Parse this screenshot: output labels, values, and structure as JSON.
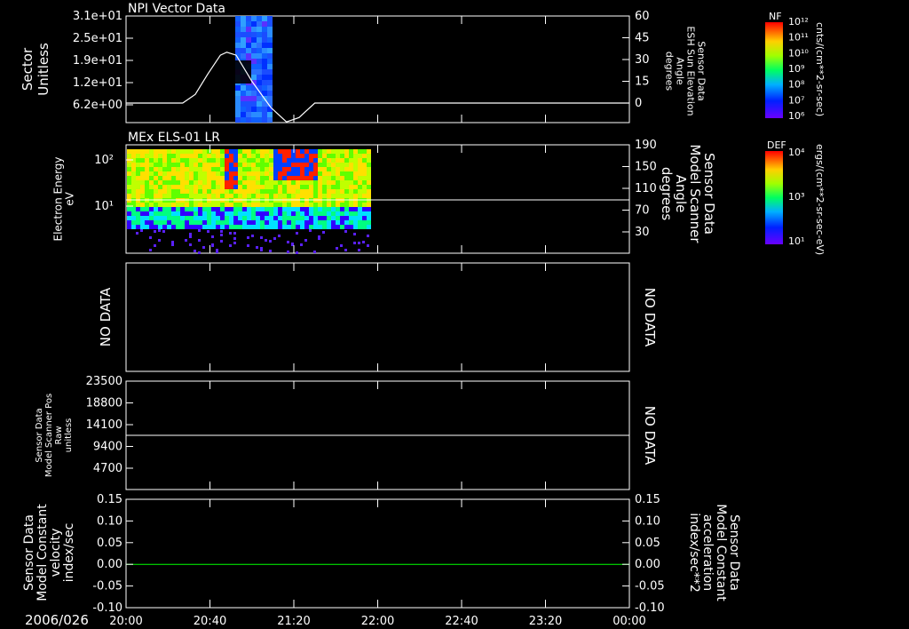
{
  "chart_data": [
    {
      "type": "heatmap",
      "title": "NPI Vector Data",
      "ylabel": "Sector\nUnitless",
      "y_ticks": [
        "3.1e+01",
        "2.5e+01",
        "1.9e+01",
        "1.2e+01",
        "6.2e+00"
      ],
      "y2label": "Sensor Data\nESH Sun Elevation\nAngle\ndegrees",
      "y2_ticks": [
        "60",
        "45",
        "30",
        "15",
        "0"
      ],
      "colorbar": {
        "label": "NF",
        "units": "cnts/(cm**2-sr-sec)",
        "ticks": [
          "10¹²",
          "10¹¹",
          "10¹⁰",
          "10⁹",
          "10⁸",
          "10⁷",
          "10⁶"
        ]
      },
      "line_series": {
        "x_hours": [
          0,
          0.5,
          0.9,
          1.1,
          1.3,
          1.5,
          1.6,
          1.75,
          2.0,
          2.3,
          2.55,
          2.75,
          3.0,
          3.2,
          3.4,
          3.6,
          4.0,
          4.5,
          5.0,
          5.5,
          6.0,
          6.5,
          7.0,
          7.5,
          8.0
        ],
        "y_deg": [
          0,
          0,
          0,
          6,
          20,
          33,
          35,
          33,
          15,
          -3,
          -13,
          -10,
          0,
          0,
          0,
          0,
          0,
          0,
          0,
          0,
          0,
          0,
          0,
          0,
          0
        ]
      }
    },
    {
      "type": "heatmap",
      "title": "MEx ELS-01 LR",
      "ylabel": "Electron Energy\neV",
      "y_ticks": [
        "10²",
        "10¹"
      ],
      "y2label": "Sensor Data\nModel Scanner\nAngle\ndegrees",
      "y2_ticks": [
        "190",
        "150",
        "110",
        "70",
        "30"
      ],
      "colorbar": {
        "label": "DEF",
        "units": "ergs/(cm**2-sr-sec-eV)",
        "ticks": [
          "10⁴",
          "10³",
          "10¹"
        ]
      },
      "hline_value": 100
    },
    {
      "type": "line",
      "ylabel": "NO DATA",
      "y2label": "NO DATA"
    },
    {
      "type": "line",
      "ylabel": "Sensor Data\nModel Scanner Pos\nRaw\nunitless",
      "y_ticks": [
        "23500",
        "18800",
        "14100",
        "9400",
        "4700"
      ],
      "y2label": "NO DATA",
      "ylim": [
        0,
        23500
      ],
      "series": [
        {
          "y": 11750
        }
      ]
    },
    {
      "type": "line",
      "ylabel": "Sensor Data\nModel Constant\nvelocity\nindex/sec",
      "y_ticks": [
        "0.15",
        "0.10",
        "0.05",
        "0.00",
        "-0.05",
        "-0.10"
      ],
      "y2label": "Sensor Data\nModel Constant\nacceleration\nindex/sec**2",
      "y2_ticks": [
        "0.15",
        "0.10",
        "0.05",
        "0.00",
        "-0.05",
        "-0.10"
      ],
      "ylim": [
        -0.1,
        0.15
      ],
      "series": [
        {
          "y": 0.0
        }
      ]
    }
  ],
  "x_axis": {
    "date": "2006/026",
    "ticks": [
      "20:00",
      "20:40",
      "21:20",
      "22:00",
      "22:40",
      "23:20",
      "00:00"
    ]
  },
  "colors": {
    "background": "#000000",
    "axis": "#ffffff",
    "accel_label": "#00ff00",
    "zero_line": "#00ff00"
  }
}
